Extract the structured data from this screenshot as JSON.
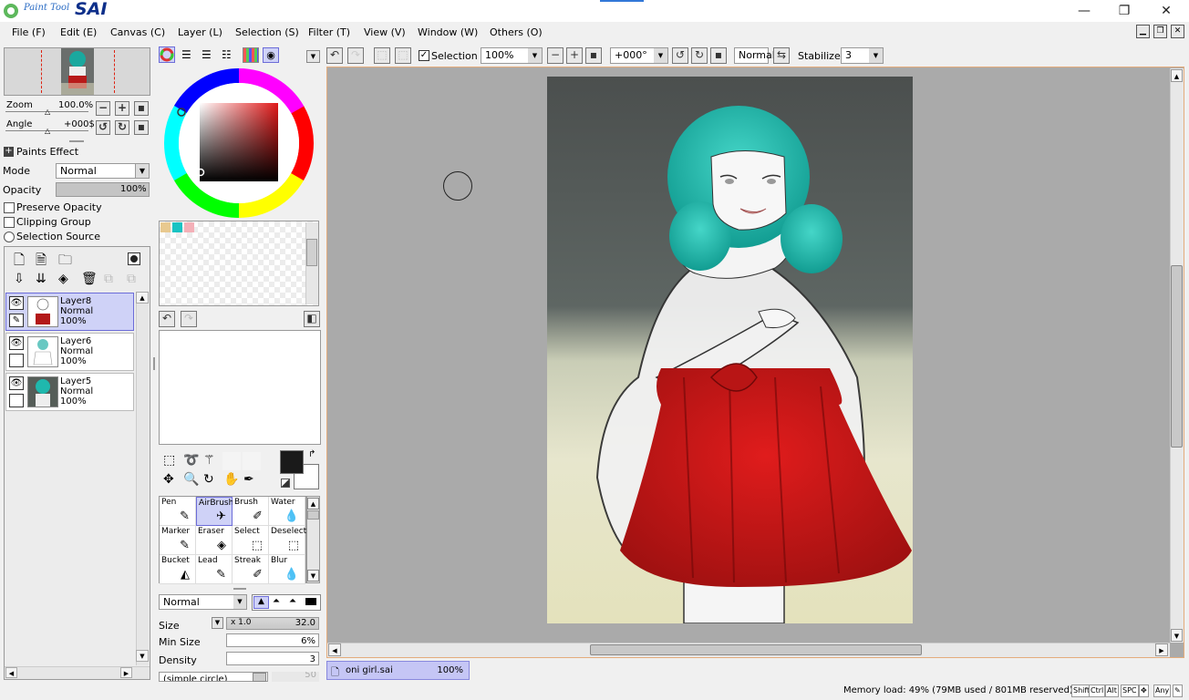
{
  "app": {
    "logo_small": "Paint Tool",
    "logo_big": "SAI"
  },
  "window_controls": {
    "minimize": "—",
    "restore": "❐",
    "close": "✕"
  },
  "menu": [
    "File (F)",
    "Edit (E)",
    "Canvas (C)",
    "Layer (L)",
    "Selection (S)",
    "Filter (T)",
    "View (V)",
    "Window (W)",
    "Others (O)"
  ],
  "navigator": {
    "zoom_label": "Zoom",
    "zoom_value": "100.0%",
    "angle_label": "Angle",
    "angle_value": "+000$"
  },
  "paint_effect": {
    "header": "Paints Effect",
    "mode_label": "Mode",
    "mode_value": "Normal",
    "opacity_label": "Opacity",
    "opacity_value": "100%",
    "opacity_fraction": 1.0,
    "preserve_opacity": "Preserve Opacity",
    "clipping_group": "Clipping Group",
    "selection_source": "Selection Source"
  },
  "layers": [
    {
      "name": "Layer8",
      "mode": "Normal",
      "opacity": "100%",
      "selected": true
    },
    {
      "name": "Layer6",
      "mode": "Normal",
      "opacity": "100%",
      "selected": false
    },
    {
      "name": "Layer5",
      "mode": "Normal",
      "opacity": "100%",
      "selected": false
    }
  ],
  "swatches": [
    "#e8c98f",
    "#19c3c3",
    "#f4b0b8"
  ],
  "colors": {
    "primary": "#1a1a1a",
    "secondary": "#ffffff",
    "selected_hue": "#e11919"
  },
  "tools": [
    {
      "label": "Pen",
      "icon": "✎"
    },
    {
      "label": "AirBrush",
      "icon": "✈",
      "selected": true
    },
    {
      "label": "Brush",
      "icon": "✐"
    },
    {
      "label": "Water",
      "icon": "💧"
    },
    {
      "label": "Marker",
      "icon": "✎"
    },
    {
      "label": "Eraser",
      "icon": "◈"
    },
    {
      "label": "Select",
      "icon": "⬚"
    },
    {
      "label": "Deselect",
      "icon": "⬚"
    },
    {
      "label": "Bucket",
      "icon": "◭"
    },
    {
      "label": "Lead",
      "icon": "✎"
    },
    {
      "label": "Streak",
      "icon": "✐"
    },
    {
      "label": "Blur",
      "icon": "💧"
    }
  ],
  "brush": {
    "blend_mode": "Normal",
    "size_label": "Size",
    "size_mult": "x 1.0",
    "size_value": "32.0",
    "min_size_label": "Min Size",
    "min_size_value": "6%",
    "density_label": "Density",
    "density_value": "3",
    "shape": "(simple circle)",
    "shape_value": "50"
  },
  "toolbar": {
    "selection_label": "Selection",
    "zoom": "100%",
    "angle": "+000°",
    "blend": "Normal",
    "stabilizer_label": "Stabilizer",
    "stabilizer_value": "3"
  },
  "document_tab": {
    "name": "oni girl.sai",
    "zoom": "100%"
  },
  "status": {
    "memory": "Memory load: 49% (79MB used / 801MB reserved)",
    "keys": [
      "Shift",
      "Ctrl",
      "Alt",
      "SPC",
      "✥",
      "Any",
      "✎"
    ]
  }
}
